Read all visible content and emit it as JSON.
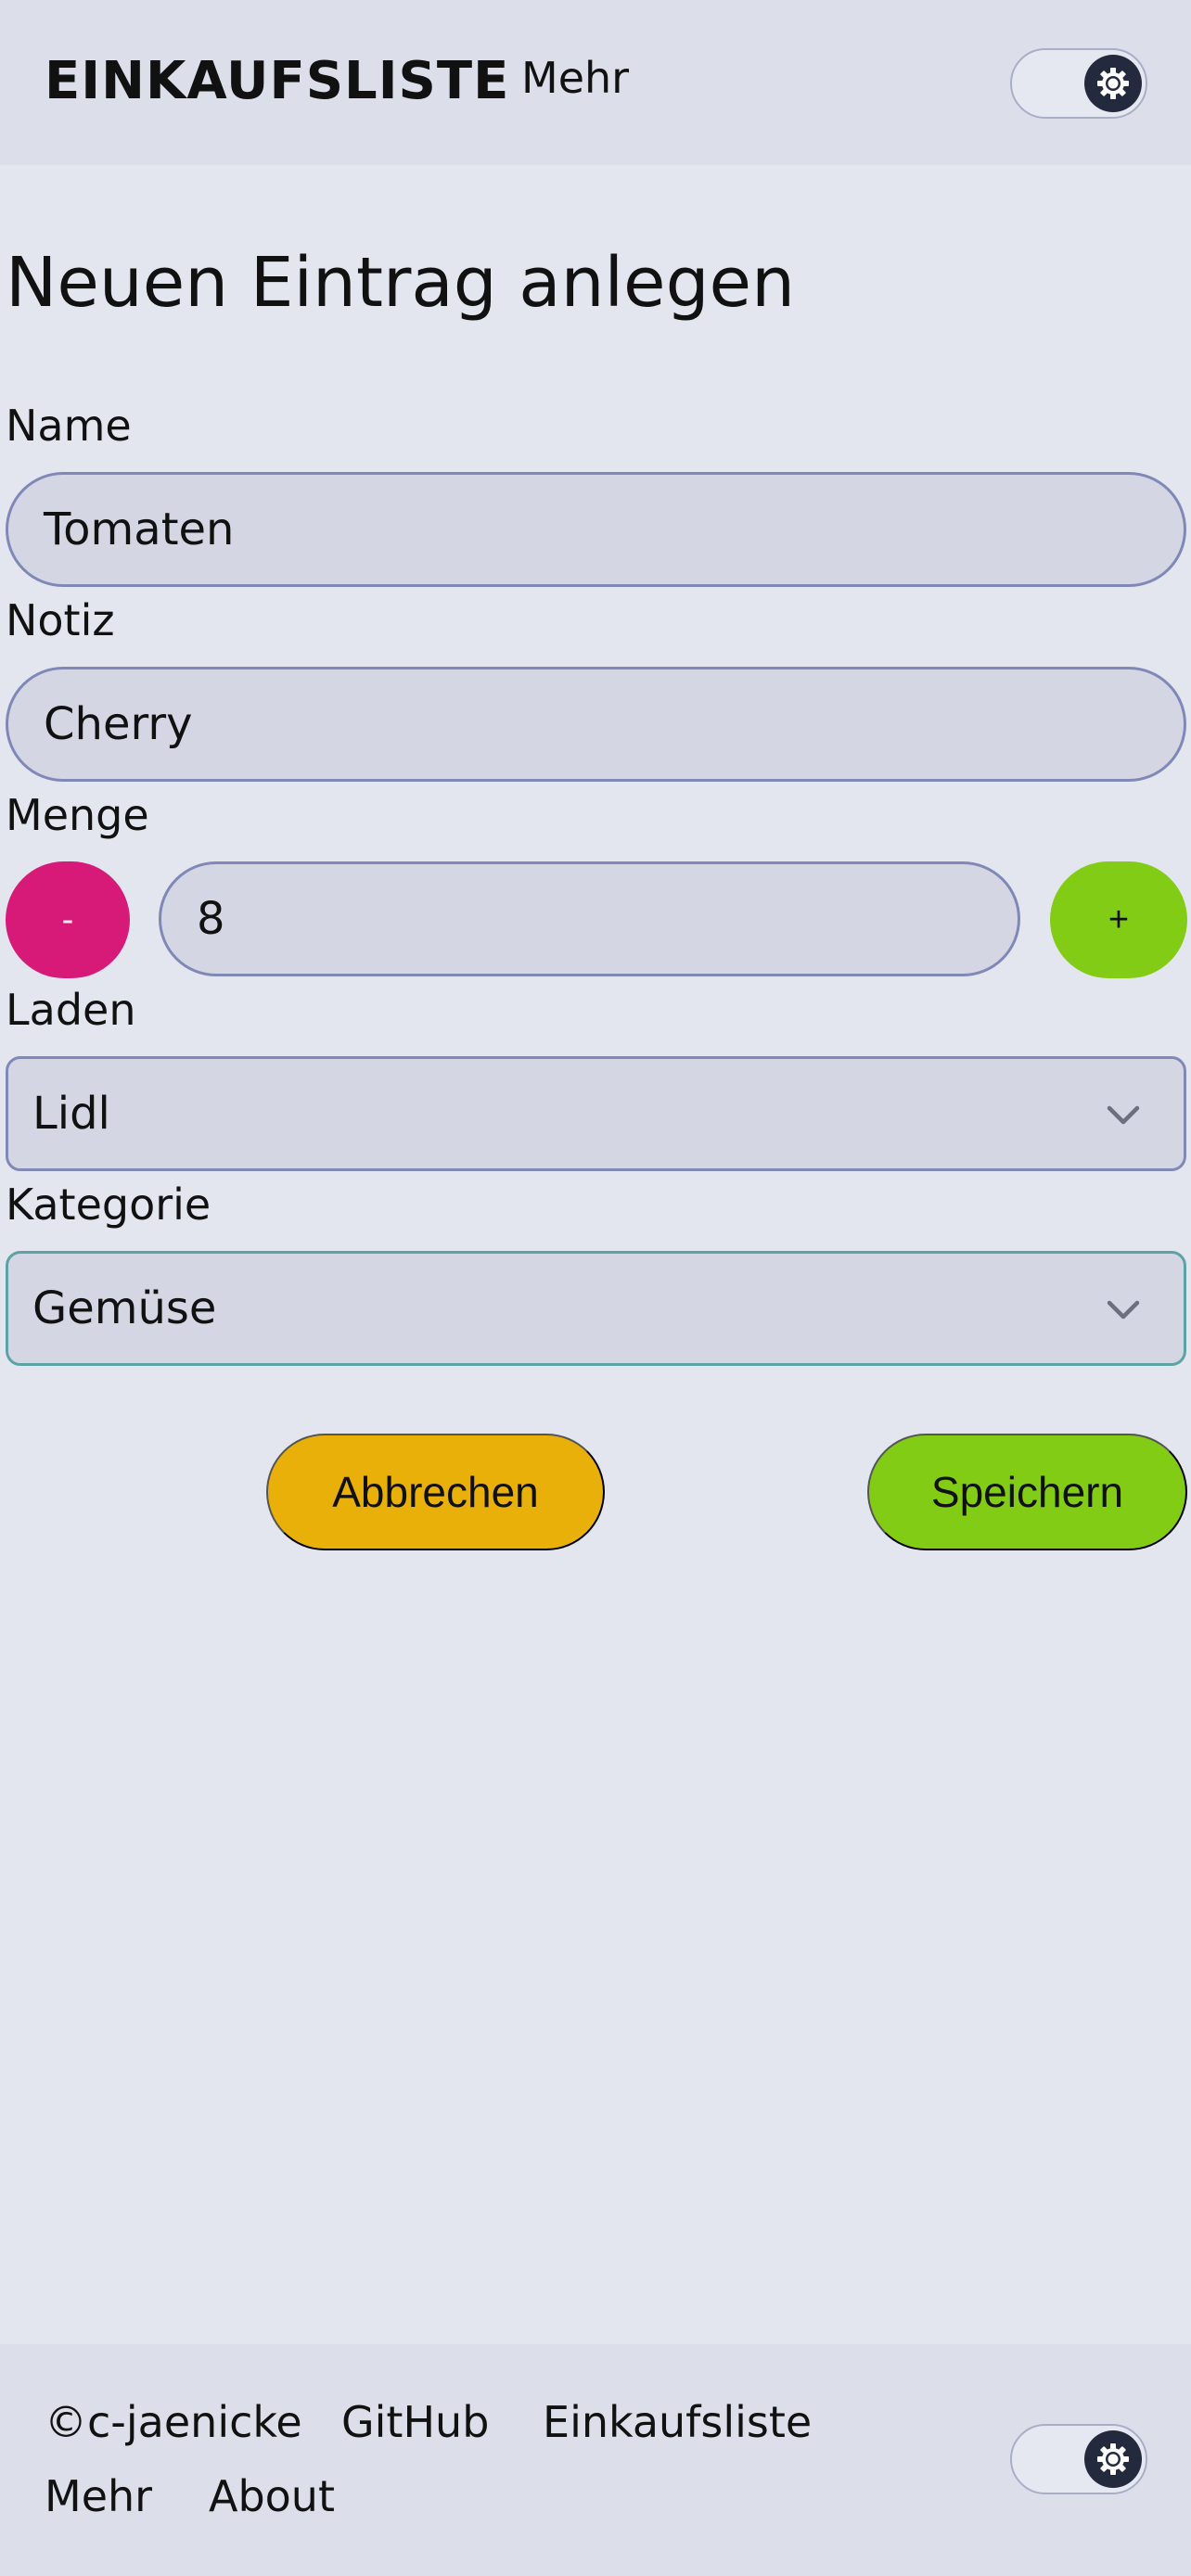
{
  "header": {
    "brand": "EINKAUFSLISTE",
    "nav_more": "Mehr",
    "theme_toggle_icon": "gear-icon"
  },
  "form": {
    "title": "Neuen Eintrag anlegen",
    "name": {
      "label": "Name",
      "value": "Tomaten"
    },
    "note": {
      "label": "Notiz",
      "value": "Cherry"
    },
    "quantity": {
      "label": "Menge",
      "value": "8",
      "decrement": "-",
      "increment": "+"
    },
    "store": {
      "label": "Laden",
      "value": "Lidl"
    },
    "category": {
      "label": "Kategorie",
      "value": "Gemüse"
    },
    "cancel_label": "Abbrechen",
    "save_label": "Speichern"
  },
  "footer": {
    "copyright": "©c-jaenicke",
    "links": [
      "GitHub",
      "Einkaufsliste",
      "Mehr",
      "About"
    ],
    "theme_toggle_icon": "gear-icon"
  },
  "colors": {
    "background": "#e3e6ef",
    "header_bg": "#dcdfea",
    "input_bg": "#d4d7e3",
    "input_border": "#8088b8",
    "decrement": "#d71a78",
    "increment": "#83cc15",
    "cancel": "#e8b008",
    "save": "#83cc15"
  }
}
